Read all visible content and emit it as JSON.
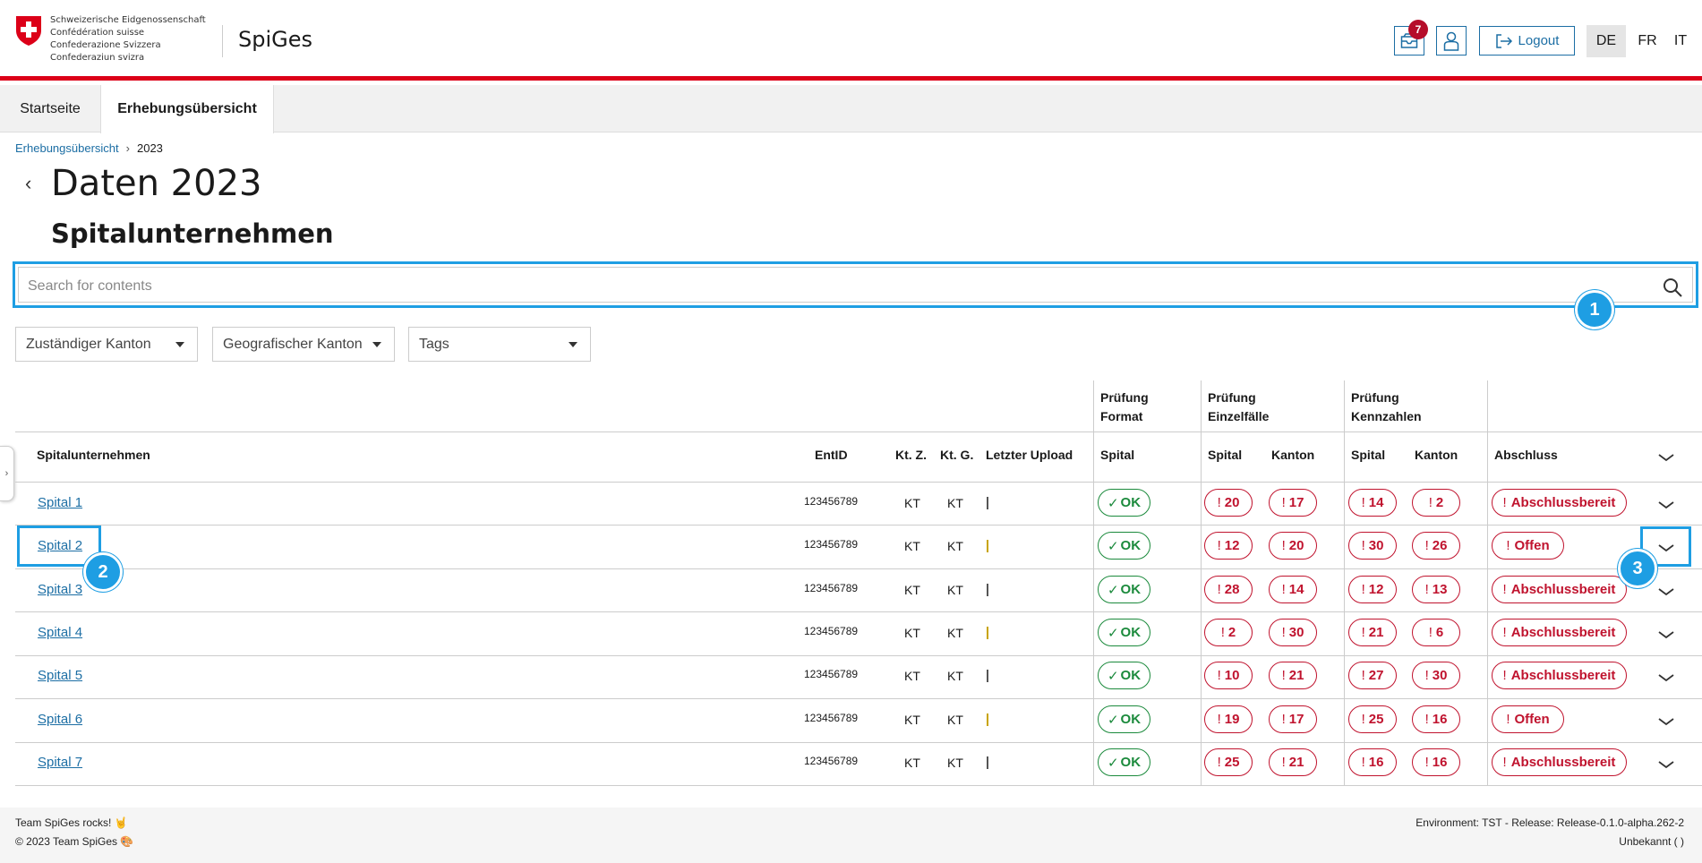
{
  "header": {
    "confederation_lines": [
      "Schweizerische Eidgenossenschaft",
      "Confédération suisse",
      "Confederazione Svizzera",
      "Confederaziun svizra"
    ],
    "app_title": "SpiGes",
    "notification_count": "7",
    "logout_label": "Logout",
    "languages": [
      "DE",
      "FR",
      "IT"
    ],
    "active_language": "DE"
  },
  "tabs": [
    {
      "label": "Startseite",
      "active": false
    },
    {
      "label": "Erhebungsübersicht",
      "active": true
    }
  ],
  "breadcrumb": {
    "link": "Erhebungsübersicht",
    "separator": "›",
    "current": "2023"
  },
  "page_title": "Daten 2023",
  "section_title": "Spitalunternehmen",
  "search": {
    "placeholder": "Search for contents",
    "value": ""
  },
  "filters": [
    {
      "label": "Zuständiger Kanton"
    },
    {
      "label": "Geografischer Kanton"
    },
    {
      "label": "Tags"
    }
  ],
  "table": {
    "group_headers": [
      {
        "line1": "Prüfung",
        "line2": "Format"
      },
      {
        "line1": "Prüfung",
        "line2": "Einzelfälle"
      },
      {
        "line1": "Prüfung",
        "line2": "Kennzahlen"
      }
    ],
    "columns": [
      "Spitalunternehmen",
      "EntID",
      "Kt. Z.",
      "Kt. G.",
      "Letzter Upload",
      "Spital",
      "Spital",
      "Kanton",
      "Spital",
      "Kanton",
      "Abschluss"
    ],
    "rows": [
      {
        "name": "Spital 1",
        "entid": "123456789",
        "ktz": "KT",
        "ktg": "KT",
        "format": "OK",
        "ef_spital": "20",
        "ef_kanton": "17",
        "kz_spital": "14",
        "kz_kanton": "2",
        "abschluss": "Abschlussbereit"
      },
      {
        "name": "Spital 2",
        "entid": "123456789",
        "ktz": "KT",
        "ktg": "KT",
        "format": "OK",
        "ef_spital": "12",
        "ef_kanton": "20",
        "kz_spital": "30",
        "kz_kanton": "26",
        "abschluss": "Offen"
      },
      {
        "name": "Spital 3",
        "entid": "123456789",
        "ktz": "KT",
        "ktg": "KT",
        "format": "OK",
        "ef_spital": "28",
        "ef_kanton": "14",
        "kz_spital": "12",
        "kz_kanton": "13",
        "abschluss": "Abschlussbereit"
      },
      {
        "name": "Spital 4",
        "entid": "123456789",
        "ktz": "KT",
        "ktg": "KT",
        "format": "OK",
        "ef_spital": "2",
        "ef_kanton": "30",
        "kz_spital": "21",
        "kz_kanton": "6",
        "abschluss": "Abschlussbereit"
      },
      {
        "name": "Spital 5",
        "entid": "123456789",
        "ktz": "KT",
        "ktg": "KT",
        "format": "OK",
        "ef_spital": "10",
        "ef_kanton": "21",
        "kz_spital": "27",
        "kz_kanton": "30",
        "abschluss": "Abschlussbereit"
      },
      {
        "name": "Spital 6",
        "entid": "123456789",
        "ktz": "KT",
        "ktg": "KT",
        "format": "OK",
        "ef_spital": "19",
        "ef_kanton": "17",
        "kz_spital": "25",
        "kz_kanton": "16",
        "abschluss": "Offen"
      },
      {
        "name": "Spital 7",
        "entid": "123456789",
        "ktz": "KT",
        "ktg": "KT",
        "format": "OK",
        "ef_spital": "25",
        "ef_kanton": "21",
        "kz_spital": "16",
        "kz_kanton": "16",
        "abschluss": "Abschlussbereit"
      }
    ]
  },
  "callouts": [
    "1",
    "2",
    "3"
  ],
  "footer": {
    "left_line1": "Team SpiGes rocks! 🤘",
    "left_line2": "© 2023 Team SpiGes 🎨",
    "right_line1": "Environment: TST - Release: Release-0.1.0-alpha.262-2",
    "right_line2": "Unbekannt (           )"
  },
  "colors": {
    "accent": "#1c6ea4",
    "brand_red": "#dc0018",
    "ok_green": "#1b8a3c",
    "error_red": "#c0132e",
    "callout_blue": "#1e9ee3"
  }
}
